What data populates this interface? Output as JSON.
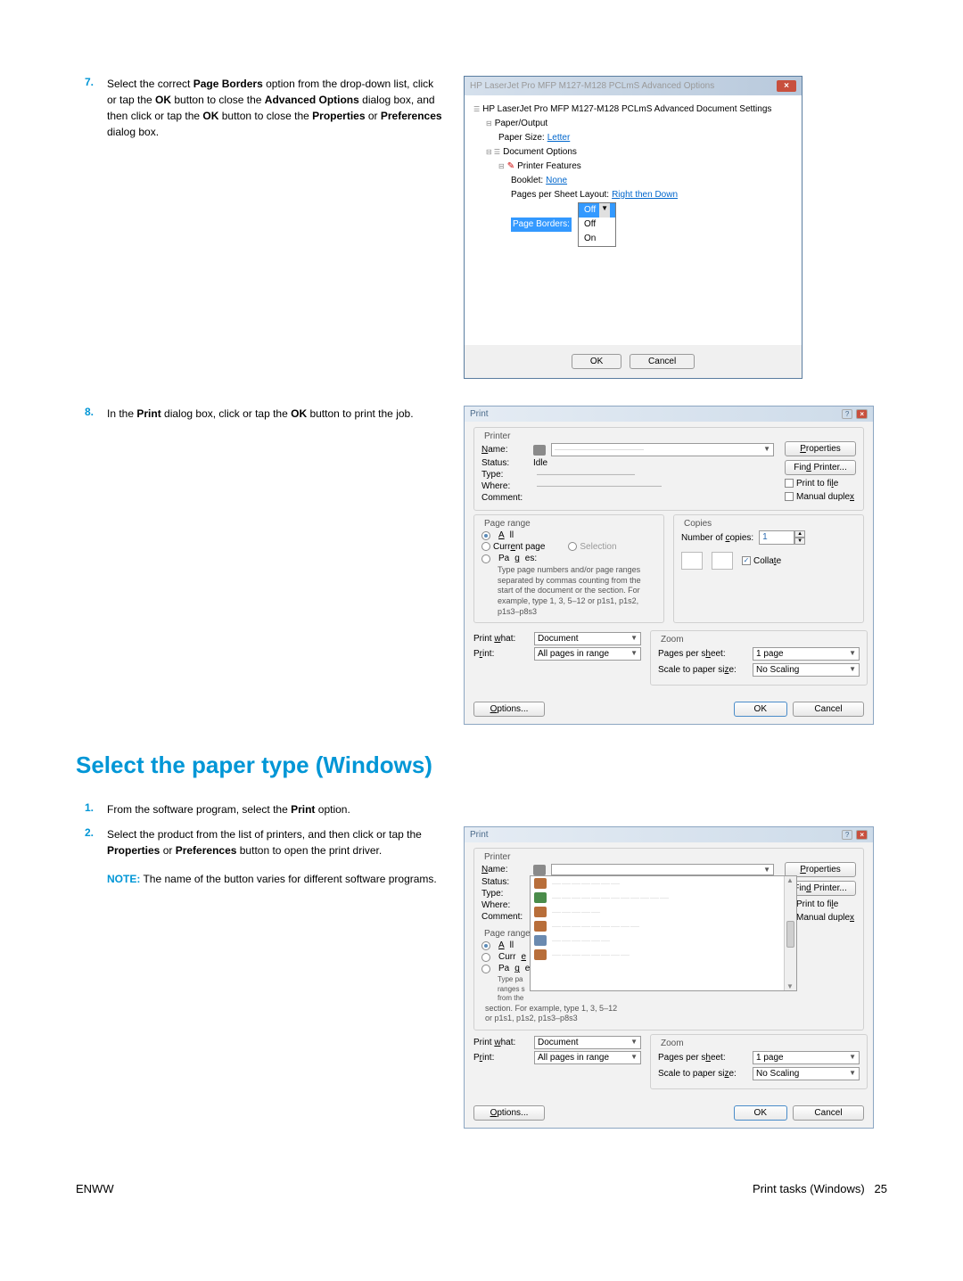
{
  "step7": {
    "num": "7.",
    "text_parts": [
      "Select the correct ",
      "Page Borders",
      " option from the drop-down list, click or tap the ",
      "OK",
      " button to close the ",
      "Advanced Options",
      " dialog box, and then click or tap the ",
      "OK",
      " button to close the ",
      "Properties",
      " or ",
      "Preferences",
      " dialog box."
    ]
  },
  "step8": {
    "num": "8.",
    "text_parts": [
      "In the ",
      "Print",
      " dialog box, click or tap the ",
      "OK",
      " button to print the job."
    ]
  },
  "section_heading": "Select the paper type (Windows)",
  "step1": {
    "num": "1.",
    "text_parts": [
      "From the software program, select the ",
      "Print",
      " option."
    ]
  },
  "step2": {
    "num": "2.",
    "text_parts_a": [
      "Select the product from the list of printers, and then click or tap the ",
      "Properties",
      " or ",
      "Preferences",
      " button to open the print driver."
    ],
    "note_label": "NOTE:",
    "note_text": "The name of the button varies for different software programs."
  },
  "advanced_dialog": {
    "title": "HP LaserJet Pro MFP M127-M128 PCLmS Advanced Options",
    "tree": {
      "root": "HP LaserJet Pro MFP M127-M128 PCLmS Advanced Document Settings",
      "paper_output": "Paper/Output",
      "paper_size_label": "Paper Size:",
      "paper_size_value": "Letter",
      "doc_options": "Document Options",
      "printer_features": "Printer Features",
      "booklet_label": "Booklet:",
      "booklet_value": "None",
      "pps_label": "Pages per Sheet Layout:",
      "pps_value": "Right then Down",
      "page_borders": "Page Borders:",
      "dd_selected": "Off",
      "dd_options": [
        "Off",
        "On"
      ]
    },
    "ok": "OK",
    "cancel": "Cancel"
  },
  "print_dialog": {
    "title": "Print",
    "printer_group": "Printer",
    "name_label": "Name:",
    "name_value": "",
    "properties_btn": "Properties",
    "status_label": "Status:",
    "status_value": "Idle",
    "find_printer_btn": "Find Printer...",
    "type_label": "Type:",
    "where_label": "Where:",
    "comment_label": "Comment:",
    "print_to_file": "Print to file",
    "manual_duplex": "Manual duplex",
    "page_range_group": "Page range",
    "all_label": "All",
    "current_page_label": "Current page",
    "selection_label": "Selection",
    "pages_label": "Pages:",
    "pages_hint": "Type page numbers and/or page ranges separated by commas counting from the start of the document or the section. For example, type 1, 3, 5–12 or p1s1, p1s2, p1s3–p8s3",
    "copies_group": "Copies",
    "num_copies_label": "Number of copies:",
    "num_copies_value": "1",
    "collate_label": "Collate",
    "print_what_label": "Print what:",
    "print_what_value": "Document",
    "print_label": "Print:",
    "print_value": "All pages in range",
    "zoom_group": "Zoom",
    "pps_label": "Pages per sheet:",
    "pps_value": "1 page",
    "scale_label": "Scale to paper size:",
    "scale_value": "No Scaling",
    "options_btn": "Options...",
    "ok_btn": "OK",
    "cancel_btn": "Cancel"
  },
  "footer": {
    "left": "ENWW",
    "right": "Print tasks (Windows)",
    "page": "25"
  }
}
